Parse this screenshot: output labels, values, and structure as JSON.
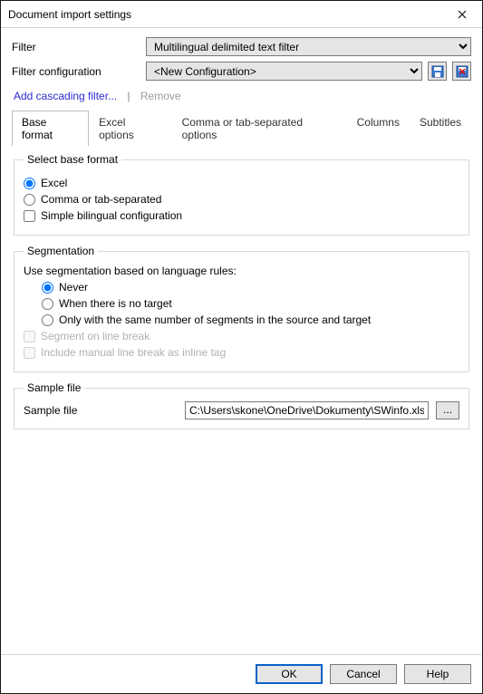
{
  "title": "Document import settings",
  "filter": {
    "label": "Filter",
    "value": "Multilingual delimited text filter"
  },
  "filter_config": {
    "label": "Filter configuration",
    "value": "<New Configuration>"
  },
  "links": {
    "add": "Add cascading filter...",
    "separator": "|",
    "remove": "Remove"
  },
  "tabs": [
    {
      "label": "Base format"
    },
    {
      "label": "Excel options"
    },
    {
      "label": "Comma or tab-separated options"
    },
    {
      "label": "Columns"
    },
    {
      "label": "Subtitles"
    }
  ],
  "base_format": {
    "legend": "Select base format",
    "excel": "Excel",
    "comma": "Comma or tab-separated",
    "simple": "Simple bilingual configuration"
  },
  "segmentation": {
    "legend": "Segmentation",
    "prompt": "Use segmentation based on language rules:",
    "never": "Never",
    "no_target": "When there is no target",
    "same_number": "Only with the same number of segments in the source and target",
    "line_break": "Segment on line break",
    "inline_tag": "Include manual line break as inline tag"
  },
  "sample": {
    "legend": "Sample file",
    "label": "Sample file",
    "path": "C:\\Users\\skone\\OneDrive\\Dokumenty\\SWinfo.xlsx",
    "browse": "..."
  },
  "buttons": {
    "ok": "OK",
    "cancel": "Cancel",
    "help": "Help"
  }
}
